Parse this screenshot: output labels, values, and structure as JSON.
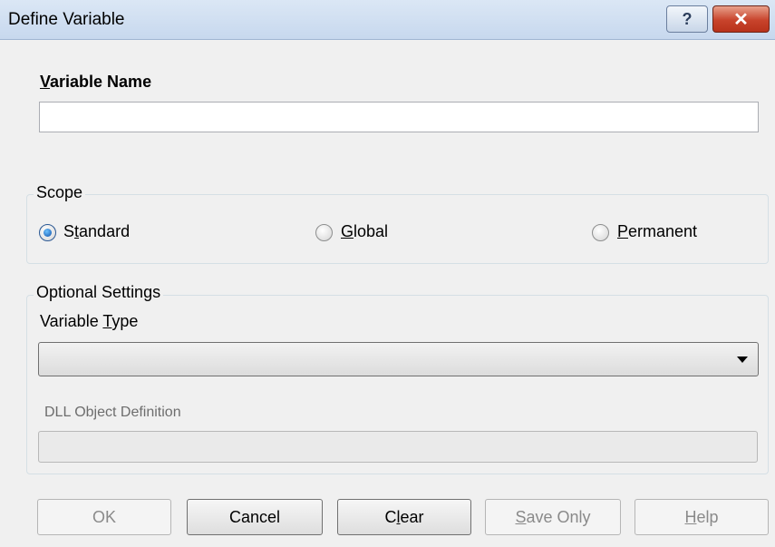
{
  "window": {
    "title": "Define Variable",
    "help_icon": "question-mark-icon",
    "close_icon": "close-x-icon",
    "help_glyph": "?",
    "close_glyph": "✕"
  },
  "variable_name": {
    "label": "Variable Name",
    "value": ""
  },
  "scope": {
    "title": "Scope",
    "selected": "Standard",
    "options": [
      "Standard",
      "Global",
      "Permanent"
    ]
  },
  "optional_settings": {
    "title": "Optional Settings",
    "variable_type_label": "Variable Type",
    "variable_type_value": "",
    "dll_label": "DLL Object Definition",
    "dll_value": ""
  },
  "buttons": {
    "ok": "OK",
    "cancel": "Cancel",
    "clear": "Clear",
    "save_only": "Save Only",
    "help": "Help"
  },
  "colors": {
    "title_bar": "#c9d9ec",
    "close_button": "#c8432b",
    "radio_selected": "#0f4fa8",
    "dialog_background": "#f0f0f0"
  }
}
